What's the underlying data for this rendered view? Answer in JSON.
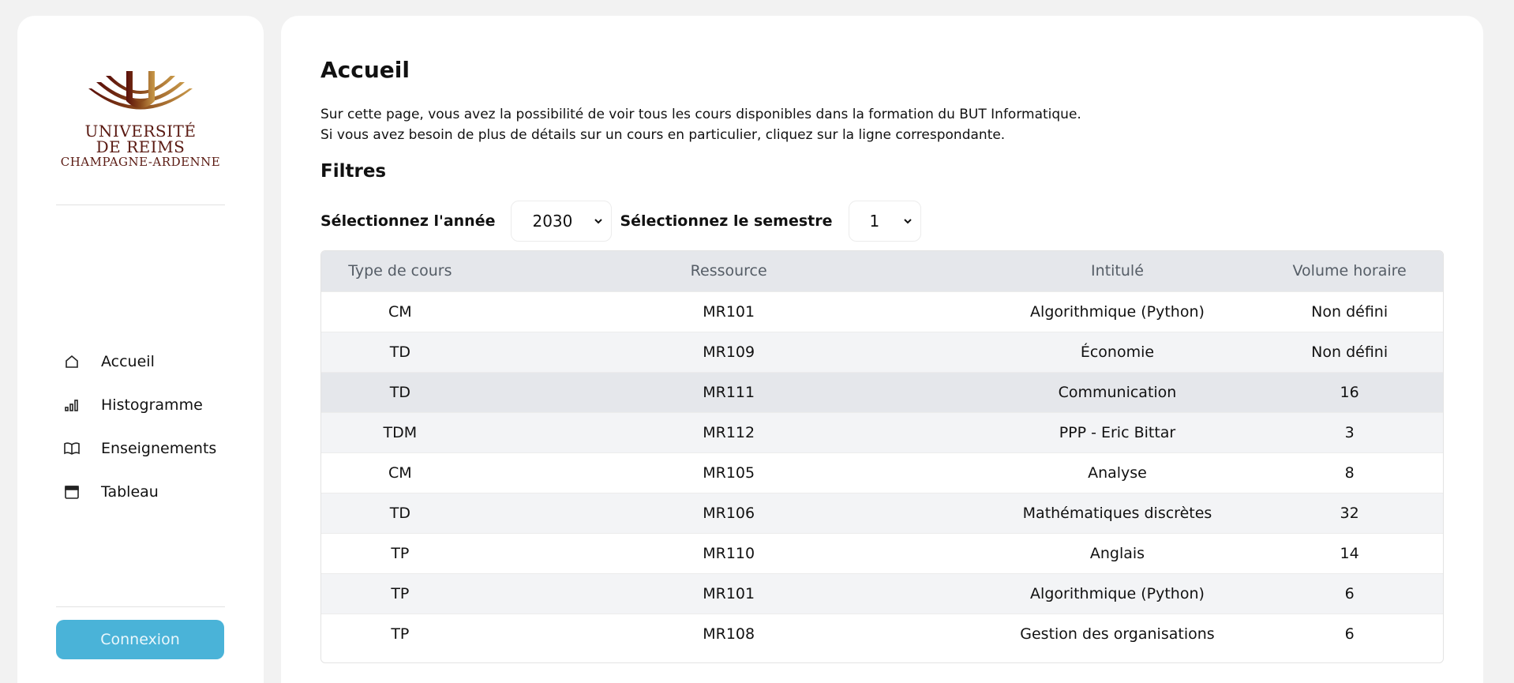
{
  "sidebar": {
    "logo": {
      "line1": "UNIVERSITÉ",
      "line2": "DE REIMS",
      "line3": "CHAMPAGNE-ARDENNE"
    },
    "nav": [
      {
        "label": "Accueil",
        "icon": "home-icon"
      },
      {
        "label": "Histogramme",
        "icon": "bar-chart-icon"
      },
      {
        "label": "Enseignements",
        "icon": "book-icon"
      },
      {
        "label": "Tableau",
        "icon": "calendar-icon"
      }
    ],
    "login_label": "Connexion",
    "login_color": "#4ab3d8"
  },
  "main": {
    "title": "Accueil",
    "intro_line1": "Sur cette page, vous avez la possibilité de voir tous les cours disponibles dans la formation du BUT Informatique.",
    "intro_line2": "Si vous avez besoin de plus de détails sur un cours en particulier, cliquez sur la ligne correspondante.",
    "filters_title": "Filtres",
    "year_label": "Sélectionnez l'année",
    "year_value": "2030",
    "semester_label": "Sélectionnez le semestre",
    "semester_value": "1",
    "table": {
      "headers": [
        "Type de cours",
        "Ressource",
        "Intitulé",
        "Volume horaire"
      ],
      "rows": [
        [
          "CM",
          "MR101",
          "Algorithmique (Python)",
          "Non défini"
        ],
        [
          "TD",
          "MR109",
          "Économie",
          "Non défini"
        ],
        [
          "TD",
          "MR111",
          "Communication",
          "16"
        ],
        [
          "TDM",
          "MR112",
          "PPP - Eric Bittar",
          "3"
        ],
        [
          "CM",
          "MR105",
          "Analyse",
          "8"
        ],
        [
          "TD",
          "MR106",
          "Mathématiques discrètes",
          "32"
        ],
        [
          "TP",
          "MR110",
          "Anglais",
          "14"
        ],
        [
          "TP",
          "MR101",
          "Algorithmique (Python)",
          "6"
        ],
        [
          "TP",
          "MR108",
          "Gestion des organisations",
          "6"
        ]
      ]
    }
  }
}
